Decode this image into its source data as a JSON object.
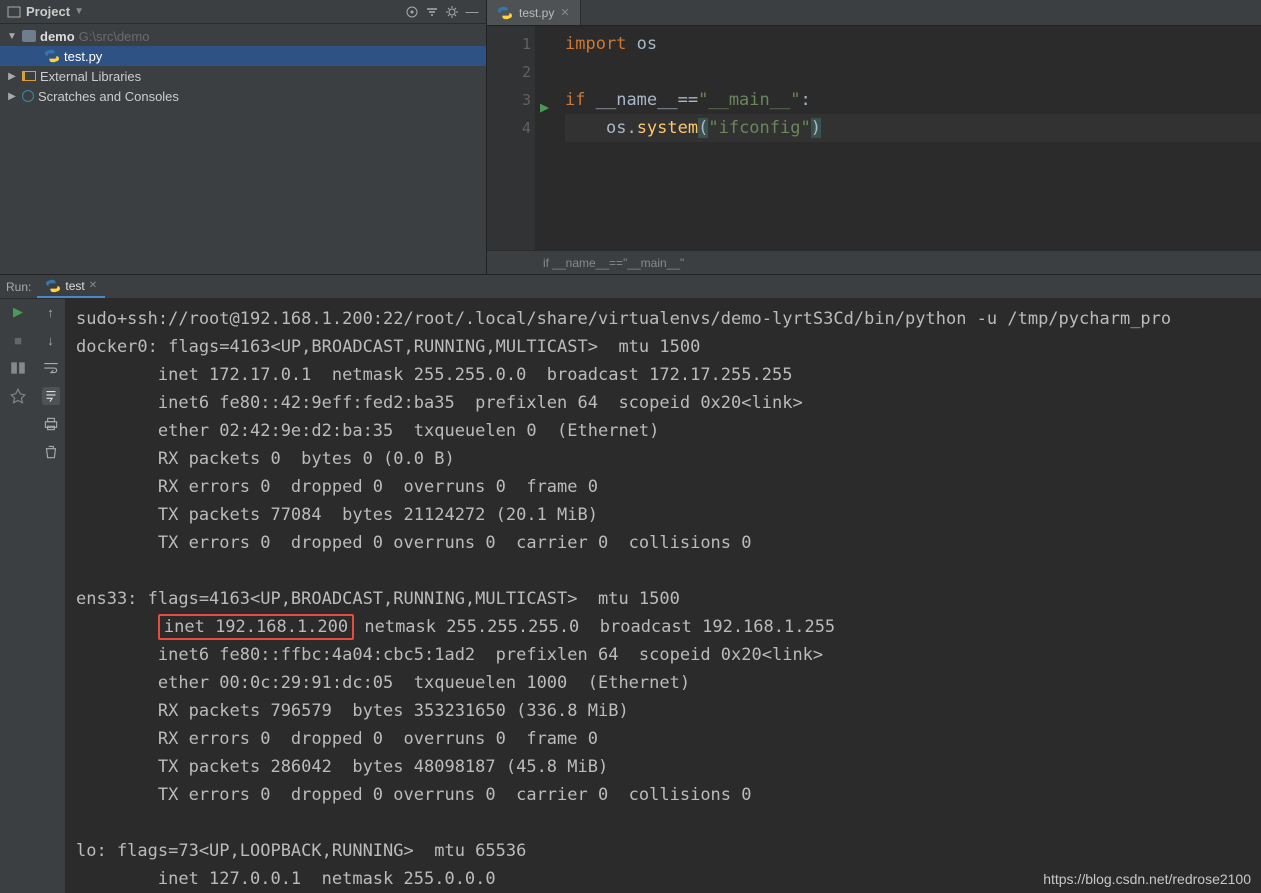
{
  "project": {
    "panel_title": "Project",
    "root_name": "demo",
    "root_path": "G:\\src\\demo",
    "file": "test.py",
    "external": "External Libraries",
    "scratches": "Scratches and Consoles"
  },
  "editor": {
    "tab": "test.py",
    "lines": [
      "1",
      "2",
      "3",
      "4"
    ],
    "code": {
      "l1_kw": "import",
      "l1_mod": "os",
      "l3_kw": "if",
      "l3_var": "__name__",
      "l3_op": "==",
      "l3_str": "\"__main__\"",
      "l3_colon": ":",
      "l4_indent": "    ",
      "l4_obj": "os",
      "l4_dot": ".",
      "l4_fn": "system",
      "l4_open": "(",
      "l4_arg": "\"ifconfig\"",
      "l4_close": ")"
    },
    "breadcrumb": "if __name__==\"__main__\""
  },
  "run": {
    "label": "Run:",
    "tab": "test",
    "output_top": "sudo+ssh://root@192.168.1.200:22/root/.local/share/virtualenvs/demo-lyrtS3Cd/bin/python -u /tmp/pycharm_pro",
    "docker_block": "docker0: flags=4163<UP,BROADCAST,RUNNING,MULTICAST>  mtu 1500\n        inet 172.17.0.1  netmask 255.255.0.0  broadcast 172.17.255.255\n        inet6 fe80::42:9eff:fed2:ba35  prefixlen 64  scopeid 0x20<link>\n        ether 02:42:9e:d2:ba:35  txqueuelen 0  (Ethernet)\n        RX packets 0  bytes 0 (0.0 B)\n        RX errors 0  dropped 0  overruns 0  frame 0\n        TX packets 77084  bytes 21124272 (20.1 MiB)\n        TX errors 0  dropped 0 overruns 0  carrier 0  collisions 0\n",
    "ens_head": "ens33: flags=4163<UP,BROADCAST,RUNNING,MULTICAST>  mtu 1500",
    "ens_hl_pre": "        ",
    "ens_hl": "inet 192.168.1.200",
    "ens_hl_post": " netmask 255.255.255.0  broadcast 192.168.1.255",
    "ens_rest": "        inet6 fe80::ffbc:4a04:cbc5:1ad2  prefixlen 64  scopeid 0x20<link>\n        ether 00:0c:29:91:dc:05  txqueuelen 1000  (Ethernet)\n        RX packets 796579  bytes 353231650 (336.8 MiB)\n        RX errors 0  dropped 0  overruns 0  frame 0\n        TX packets 286042  bytes 48098187 (45.8 MiB)\n        TX errors 0  dropped 0 overruns 0  carrier 0  collisions 0\n",
    "lo_block": "lo: flags=73<UP,LOOPBACK,RUNNING>  mtu 65536\n        inet 127.0.0.1  netmask 255.0.0.0"
  },
  "watermark": "https://blog.csdn.net/redrose2100"
}
